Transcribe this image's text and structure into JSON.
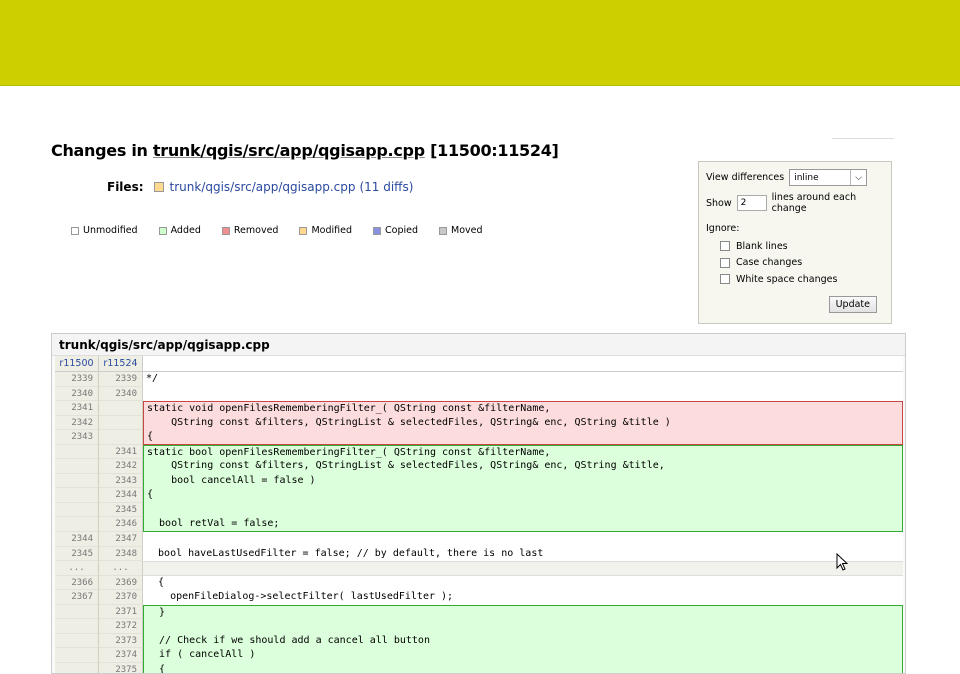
{
  "page": {
    "title_prefix": "Changes in ",
    "title_path": "trunk/qgis/src/app/qgisapp.cpp",
    "title_range": " [11500:11524]"
  },
  "files": {
    "label": "Files:",
    "link": "trunk/qgis/src/app/qgisapp.cpp",
    "count": "(11 diffs)"
  },
  "legend": [
    {
      "label": "Unmodified",
      "color": "#ffffff"
    },
    {
      "label": "Added",
      "color": "#ccffcc"
    },
    {
      "label": "Removed",
      "color": "#f09090"
    },
    {
      "label": "Modified",
      "color": "#ffd890"
    },
    {
      "label": "Copied",
      "color": "#8890e0"
    },
    {
      "label": "Moved",
      "color": "#c8c8c8"
    }
  ],
  "options": {
    "view_label": "View differences",
    "view_value": "inline",
    "show_label": "Show",
    "show_value": "2",
    "show_suffix": "lines around each change",
    "ignore_label": "Ignore:",
    "ignore_items": [
      "Blank lines",
      "Case changes",
      "White space changes"
    ],
    "update_label": "Update"
  },
  "diff": {
    "file_title": "trunk/qgis/src/app/qgisapp.cpp",
    "old_rev": "r11500",
    "new_rev": "r11524",
    "rows": [
      {
        "type": "ctx",
        "old": "2339",
        "new": "2339",
        "code": "*/"
      },
      {
        "type": "ctx",
        "old": "2340",
        "new": "2340",
        "code": ""
      },
      {
        "type": "rem",
        "old": "2341",
        "new": "",
        "code": "static void openFilesRememberingFilter_( QString const &filterName,"
      },
      {
        "type": "rem",
        "old": "2342",
        "new": "",
        "code": "    QString const &filters, QStringList & selectedFiles, QString& enc, QString &title )"
      },
      {
        "type": "rem",
        "old": "2343",
        "new": "",
        "code": "{"
      },
      {
        "type": "add",
        "old": "",
        "new": "2341",
        "code": "static bool openFilesRememberingFilter_( QString const &filterName,"
      },
      {
        "type": "add",
        "old": "",
        "new": "2342",
        "code": "    QString const &filters, QStringList & selectedFiles, QString& enc, QString &title,"
      },
      {
        "type": "add",
        "old": "",
        "new": "2343",
        "code": "    bool cancelAll = false )"
      },
      {
        "type": "add",
        "old": "",
        "new": "2344",
        "code": "{"
      },
      {
        "type": "add",
        "old": "",
        "new": "2345",
        "code": ""
      },
      {
        "type": "add",
        "old": "",
        "new": "2346",
        "code": "  bool retVal = false;"
      },
      {
        "type": "ctx",
        "old": "2344",
        "new": "2347",
        "code": ""
      },
      {
        "type": "ctx",
        "old": "2345",
        "new": "2348",
        "code": "  bool haveLastUsedFilter = false; // by default, there is no last"
      },
      {
        "type": "skip",
        "old": "...",
        "new": "...",
        "code": ""
      },
      {
        "type": "ctx",
        "old": "2366",
        "new": "2369",
        "code": "  {"
      },
      {
        "type": "ctx",
        "old": "2367",
        "new": "2370",
        "code": "    openFileDialog->selectFilter( lastUsedFilter );"
      },
      {
        "type": "add",
        "old": "",
        "new": "2371",
        "code": "  }"
      },
      {
        "type": "add",
        "old": "",
        "new": "2372",
        "code": ""
      },
      {
        "type": "add",
        "old": "",
        "new": "2373",
        "code": "  // Check if we should add a cancel all button"
      },
      {
        "type": "add",
        "old": "",
        "new": "2374",
        "code": "  if ( cancelAll )"
      },
      {
        "type": "add",
        "old": "",
        "new": "2375",
        "code": "  {"
      }
    ]
  }
}
